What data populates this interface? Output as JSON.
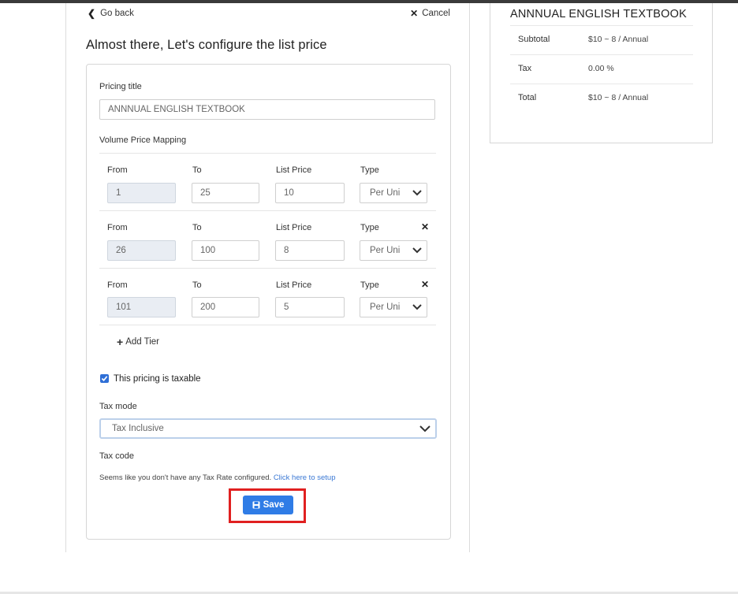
{
  "nav": {
    "go_back": "Go back",
    "cancel": "Cancel"
  },
  "page_title": "Almost there, Let's configure the list price",
  "form": {
    "pricing_title_label": "Pricing title",
    "pricing_title_value": "ANNNUAL ENGLISH TEXTBOOK",
    "volume_label": "Volume Price Mapping",
    "tier_headers": {
      "from": "From",
      "to": "To",
      "list_price": "List Price",
      "type": "Type"
    },
    "tiers": [
      {
        "from": "1",
        "to": "25",
        "price": "10",
        "type": "Per Uni"
      },
      {
        "from": "26",
        "to": "100",
        "price": "8",
        "type": "Per Uni"
      },
      {
        "from": "101",
        "to": "200",
        "price": "5",
        "type": "Per Uni"
      }
    ],
    "add_tier": "Add Tier",
    "taxable_label": "This pricing is taxable",
    "taxable_checked": true,
    "tax_mode_label": "Tax mode",
    "tax_mode_value": "Tax Inclusive",
    "tax_code_label": "Tax code",
    "tax_info": "Seems like you don't have any Tax Rate configured.",
    "tax_link": "Click here to setup",
    "save": "Save"
  },
  "summary": {
    "title": "ANNNUAL ENGLISH TEXTBOOK",
    "rows": [
      {
        "label": "Subtotal",
        "value": "$10 ~ 8 / Annual"
      },
      {
        "label": "Tax",
        "value": "0.00 %"
      },
      {
        "label": "Total",
        "value": "$10 ~ 8 / Annual"
      }
    ]
  },
  "colors": {
    "accent": "#2f7ce6",
    "highlight_border": "#e02020",
    "checkbox": "#2f6fd6",
    "link": "#3a78d4"
  },
  "icons": [
    "chevron-left-icon",
    "close-icon",
    "chevron-down-icon",
    "plus-icon",
    "check-icon",
    "save-icon"
  ]
}
